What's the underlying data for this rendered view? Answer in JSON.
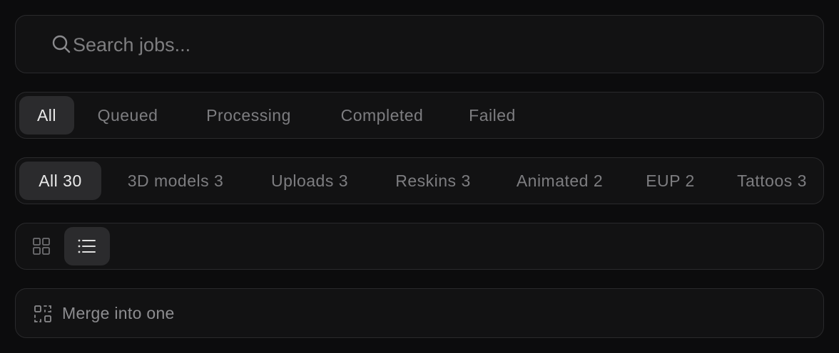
{
  "search": {
    "placeholder": "Search jobs..."
  },
  "status_tabs": [
    {
      "label": "All",
      "active": true
    },
    {
      "label": "Queued"
    },
    {
      "label": "Processing"
    },
    {
      "label": "Completed"
    },
    {
      "label": "Failed"
    }
  ],
  "type_tabs": [
    {
      "label": "All 30",
      "active": true
    },
    {
      "label": "3D models 3"
    },
    {
      "label": "Uploads 3"
    },
    {
      "label": "Reskins 3"
    },
    {
      "label": "Animated 2"
    },
    {
      "label": "EUP 2"
    },
    {
      "label": "Tattoos 3"
    }
  ],
  "view_toggle": {
    "grid_icon": "grid-icon",
    "list_icon": "list-icon",
    "selected": "list"
  },
  "merge": {
    "label": "Merge into one",
    "icon": "merge-icon"
  }
}
